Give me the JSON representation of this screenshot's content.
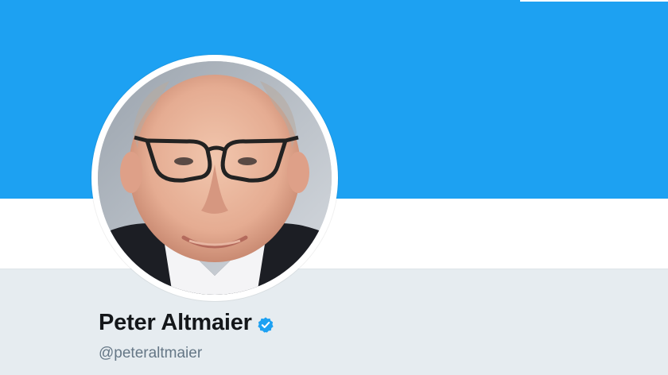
{
  "profile": {
    "name": "Peter Altmaier",
    "handle": "@peteraltmaier",
    "verified": true
  },
  "icons": {
    "verified": "verified-badge-icon",
    "avatar": "profile-photo"
  },
  "colors": {
    "banner": "#1da1f2",
    "background": "#e6ecf0",
    "name": "#14171a",
    "handle": "#657786",
    "verified_badge": "#1da1f2"
  }
}
